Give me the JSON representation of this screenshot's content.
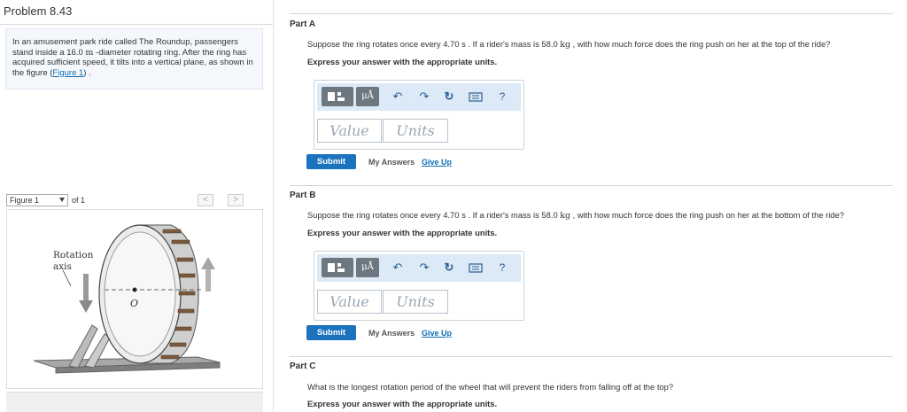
{
  "problem": {
    "title": "Problem 8.43",
    "text_before": "In an amusement park ride called The Roundup, passengers stand inside a 16.0 ",
    "unit_m": "m",
    "text_after": " -diameter rotating ring. After the ring has acquired sufficient speed, it tilts into a vertical plane, as shown in the figure (",
    "figure_link": "Figure 1",
    "text_end": ") ."
  },
  "figure": {
    "select_value": "Figure 1",
    "of_label": "of 1",
    "prev_icon": "chevron-left-icon",
    "next_icon": "chevron-right-icon",
    "prev_glyph": "<",
    "next_glyph": ">",
    "rotation_label_1": "Rotation",
    "rotation_label_2": "axis",
    "center_label": "O",
    "colors": {
      "ring_fill": "#d9d9d9",
      "ring_stroke": "#555555",
      "base": "#8a8a8a",
      "rider": "#7a5a3c"
    }
  },
  "parts": [
    {
      "title": "Part A",
      "q_before": "Suppose the ring rotates once every 4.70 s . If a rider's mass is 58.0 ",
      "q_unit": "kg",
      "q_after": " , with how much force does the ring push on her at the top of the ride?",
      "express": "Express your answer with the appropriate units.",
      "value_placeholder": "Value",
      "units_placeholder": "Units",
      "submit": "Submit",
      "my_answers": "My Answers",
      "give_up": "Give Up"
    },
    {
      "title": "Part B",
      "q_before": "Suppose the ring rotates once every 4.70 s . If a rider's mass is 58.0 ",
      "q_unit": "kg",
      "q_after": " , with how much force does the ring push on her at the bottom of the ride?",
      "express": "Express your answer with the appropriate units.",
      "value_placeholder": "Value",
      "units_placeholder": "Units",
      "submit": "Submit",
      "my_answers": "My Answers",
      "give_up": "Give Up"
    },
    {
      "title": "Part C",
      "question": "What is the longest rotation period of the wheel that will prevent the riders from falling off at the top?",
      "express": "Express your answer with the appropriate units."
    }
  ],
  "toolbar": {
    "templates_icon": "templates-icon",
    "units_label": "μÅ",
    "undo_icon": "undo-icon",
    "redo_icon": "redo-icon",
    "reset_icon": "reset-icon",
    "keyboard_icon": "keyboard-icon",
    "help_label": "?",
    "undo_glyph": "↶",
    "redo_glyph": "↷",
    "reset_glyph": "↻",
    "accent": "#dce9f6"
  }
}
